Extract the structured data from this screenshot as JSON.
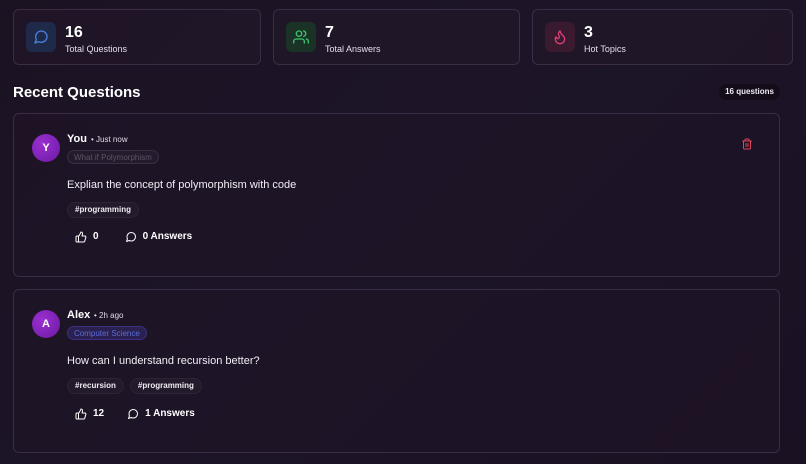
{
  "stats": [
    {
      "value": "16",
      "label": "Total Questions",
      "icon": "chat-bubble-icon",
      "color": "#4a7fe0"
    },
    {
      "value": "7",
      "label": "Total Answers",
      "icon": "users-icon",
      "color": "#3ec46d"
    },
    {
      "value": "3",
      "label": "Hot Topics",
      "icon": "flame-icon",
      "color": "#e0407a"
    }
  ],
  "section": {
    "title": "Recent Questions",
    "count": "16 questions"
  },
  "questions": [
    {
      "avatar": "Y",
      "author": "You",
      "time": "• Just now",
      "category": "What if Polymorphism",
      "text": "Explian the concept of polymorphism with code",
      "tags": [
        "#programming"
      ],
      "likes": "0",
      "answers": "0 Answers",
      "deletable": true
    },
    {
      "avatar": "A",
      "author": "Alex",
      "time": "• 2h ago",
      "category": "Computer Science",
      "text": "How can I understand recursion better?",
      "tags": [
        "#recursion",
        "#programming"
      ],
      "likes": "12",
      "answers": "1 Answers",
      "deletable": false
    }
  ],
  "colors": {
    "delete": "#e0445a",
    "accent_purple": "#8b2fc9"
  }
}
